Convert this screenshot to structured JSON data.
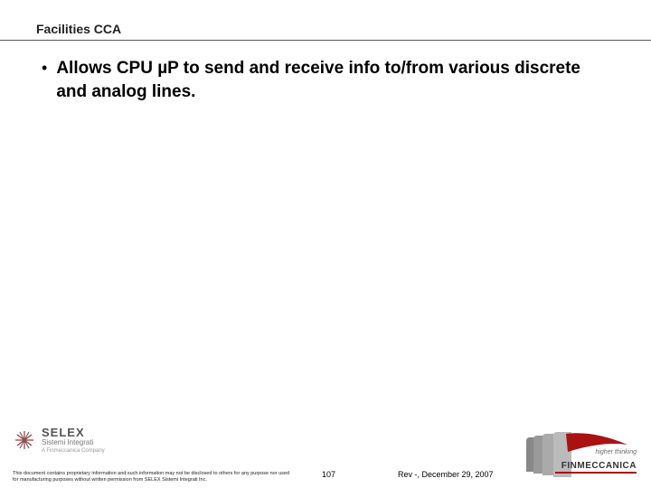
{
  "header": {
    "title": "Facilities CCA"
  },
  "content": {
    "bullet1": "Allows CPU µP to send and receive info to/from various discrete and analog lines."
  },
  "footer": {
    "selex": {
      "name": "SELEX",
      "sub": "Sistemi Integrati",
      "tag": "A Finmeccanica Company"
    },
    "disclaimer": "This document contains proprietary information and such information may not be disclosed to others for any purpose nor used for manufacturing purposes without written permission from SELEX Sistemi Integrati Inc.",
    "page": "107",
    "rev": "Rev -, December 29, 2007",
    "finmeccanica": {
      "tag": "higher thinking",
      "name": "FINMECCANICA"
    }
  }
}
